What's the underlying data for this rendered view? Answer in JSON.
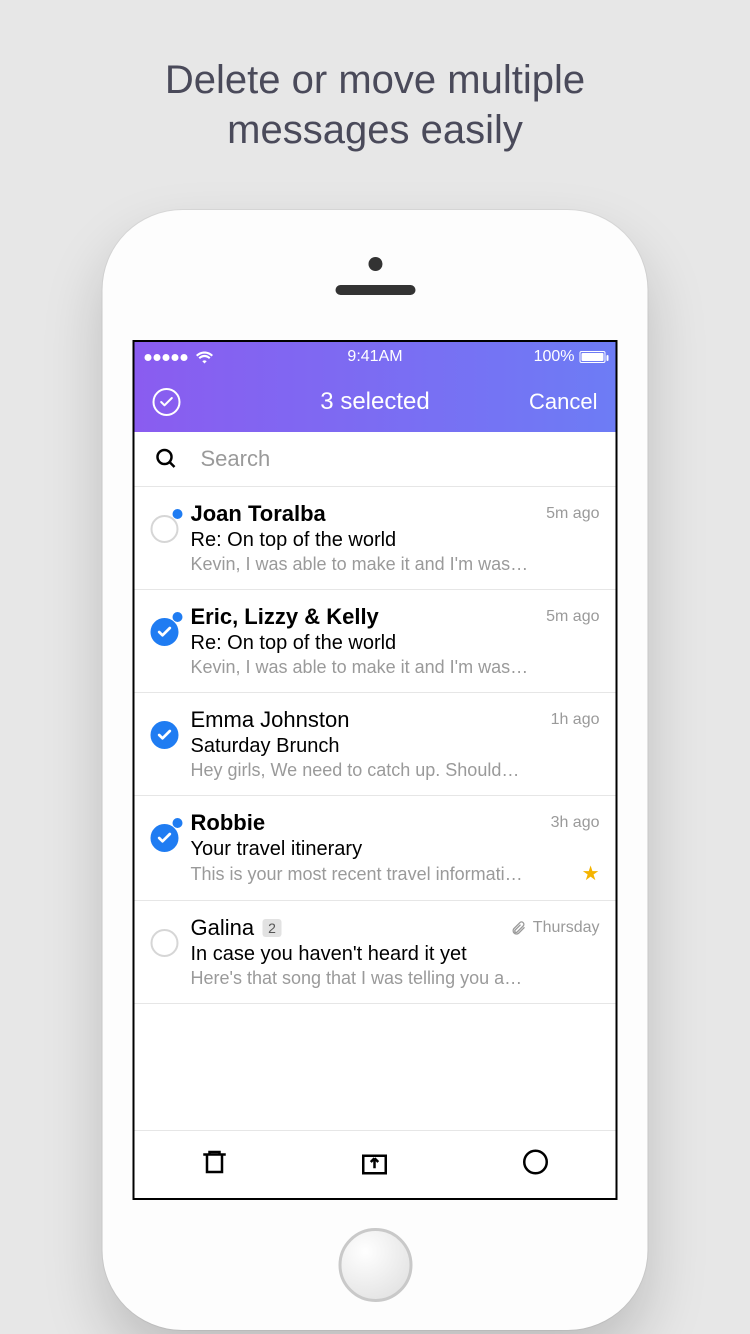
{
  "promo": {
    "line1": "Delete or move multiple",
    "line2": "messages easily"
  },
  "status": {
    "time": "9:41AM",
    "battery": "100%"
  },
  "nav": {
    "title": "3 selected",
    "cancel": "Cancel"
  },
  "search": {
    "placeholder": "Search"
  },
  "emails": [
    {
      "sender": "Joan Toralba",
      "subject": "Re: On top of the world",
      "preview": "Kevin, I was able to make it and I'm was…",
      "time": "5m ago",
      "unread": true,
      "selected": false,
      "starred": false,
      "attachment": false,
      "count": null
    },
    {
      "sender": "Eric, Lizzy & Kelly",
      "subject": "Re: On top of the world",
      "preview": "Kevin, I was able to make it and I'm was…",
      "time": "5m ago",
      "unread": true,
      "selected": true,
      "starred": false,
      "attachment": false,
      "count": null
    },
    {
      "sender": "Emma Johnston",
      "subject": "Saturday Brunch",
      "preview": "Hey girls, We need to catch up. Should…",
      "time": "1h ago",
      "unread": false,
      "selected": true,
      "starred": false,
      "attachment": false,
      "count": null
    },
    {
      "sender": "Robbie",
      "subject": "Your travel itinerary",
      "preview": "This is your most recent travel informati…",
      "time": "3h ago",
      "unread": true,
      "selected": true,
      "starred": true,
      "attachment": false,
      "count": null
    },
    {
      "sender": "Galina",
      "subject": "In case you haven't heard it yet",
      "preview": "Here's that song that I was telling you a…",
      "time": "Thursday",
      "unread": false,
      "selected": false,
      "starred": false,
      "attachment": true,
      "count": "2"
    }
  ]
}
